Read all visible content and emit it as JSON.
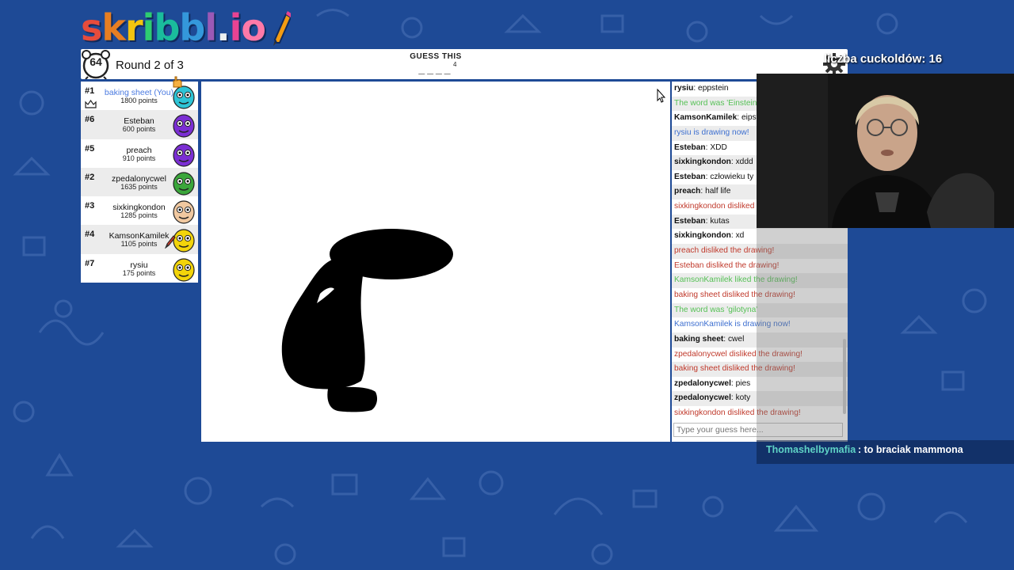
{
  "app": {
    "logo_text": [
      "s",
      "k",
      "r",
      "i",
      "b",
      "b",
      "l",
      ".",
      "i",
      "o"
    ]
  },
  "colors": {
    "logo": [
      "#e74c3c",
      "#e67e22",
      "#f1c40f",
      "#2ecc71",
      "#1abc9c",
      "#3498db",
      "#9b59b6",
      "#ecf0f1",
      "#e84393",
      "#fd79a8"
    ],
    "background": "#1e4a96",
    "chat_red": "#c0392b",
    "chat_green": "#56c156",
    "chat_blue": "#3d6fd0",
    "you_blue": "#4a7ae0"
  },
  "header": {
    "timer": "64",
    "round": "Round 2 of 3",
    "guess_label": "GUESS THIS",
    "word_blanks": "____",
    "word_length": "4",
    "settings_icon": "gear-icon"
  },
  "players": [
    {
      "rank": "#1",
      "name": "baking sheet (You)",
      "points": "1800 points",
      "avatar_color": "#2ec4d6",
      "you": true,
      "crown": true,
      "drawing": false
    },
    {
      "rank": "#6",
      "name": "Esteban",
      "points": "600 points",
      "avatar_color": "#7b2fd3",
      "you": false,
      "crown": false,
      "drawing": false
    },
    {
      "rank": "#5",
      "name": "preach",
      "points": "910 points",
      "avatar_color": "#7b2fd3",
      "you": false,
      "crown": false,
      "drawing": false
    },
    {
      "rank": "#2",
      "name": "zpedalonycwel",
      "points": "1635 points",
      "avatar_color": "#3ba63b",
      "you": false,
      "crown": false,
      "drawing": false
    },
    {
      "rank": "#3",
      "name": "sixkingkondon",
      "points": "1285 points",
      "avatar_color": "#f0c8a0",
      "you": false,
      "crown": false,
      "drawing": false
    },
    {
      "rank": "#4",
      "name": "KamsonKamilek",
      "points": "1105 points",
      "avatar_color": "#f2d40a",
      "you": false,
      "crown": false,
      "drawing": true
    },
    {
      "rank": "#7",
      "name": "rysiu",
      "points": "175 points",
      "avatar_color": "#f2d40a",
      "you": false,
      "crown": false,
      "drawing": false
    }
  ],
  "chat": {
    "messages": [
      {
        "kind": "msg",
        "user": "rysiu",
        "text": "eppstein"
      },
      {
        "kind": "green",
        "text": "The word was 'Einstein'"
      },
      {
        "kind": "msg",
        "user": "KamsonKamilek",
        "text": "eipstein"
      },
      {
        "kind": "blue",
        "text": "rysiu is drawing now!"
      },
      {
        "kind": "msg",
        "user": "Esteban",
        "text": "XDD"
      },
      {
        "kind": "msg",
        "user": "sixkingkondon",
        "text": "xddd"
      },
      {
        "kind": "msg",
        "user": "Esteban",
        "text": "człowieku ty"
      },
      {
        "kind": "msg",
        "user": "preach",
        "text": "half life"
      },
      {
        "kind": "red",
        "text": "sixkingkondon disliked the drawing!"
      },
      {
        "kind": "msg",
        "user": "Esteban",
        "text": "kutas"
      },
      {
        "kind": "msg",
        "user": "sixkingkondon",
        "text": "xd"
      },
      {
        "kind": "red",
        "text": "preach disliked the drawing!"
      },
      {
        "kind": "red",
        "text": "Esteban disliked the drawing!"
      },
      {
        "kind": "green",
        "text": "KamsonKamilek liked the drawing!"
      },
      {
        "kind": "red",
        "text": "baking sheet disliked the drawing!"
      },
      {
        "kind": "green",
        "text": "The word was 'gilotyna'"
      },
      {
        "kind": "blue",
        "text": "KamsonKamilek is drawing now!"
      },
      {
        "kind": "msg",
        "user": "baking sheet",
        "text": "cwel"
      },
      {
        "kind": "red",
        "text": "zpedalonycwel disliked the drawing!"
      },
      {
        "kind": "red",
        "text": "baking sheet disliked the drawing!"
      },
      {
        "kind": "msg",
        "user": "zpedalonycwel",
        "text": "pies"
      },
      {
        "kind": "msg",
        "user": "zpedalonycwel",
        "text": "koty"
      },
      {
        "kind": "red",
        "text": "sixkingkondon disliked the drawing!"
      }
    ],
    "input_placeholder": "Type your guess here..."
  },
  "overlay": {
    "counter": "liczba cuckoldów: 16",
    "twitch_user": "Thomashelbymafia",
    "twitch_message": ": to braciak mammona"
  }
}
